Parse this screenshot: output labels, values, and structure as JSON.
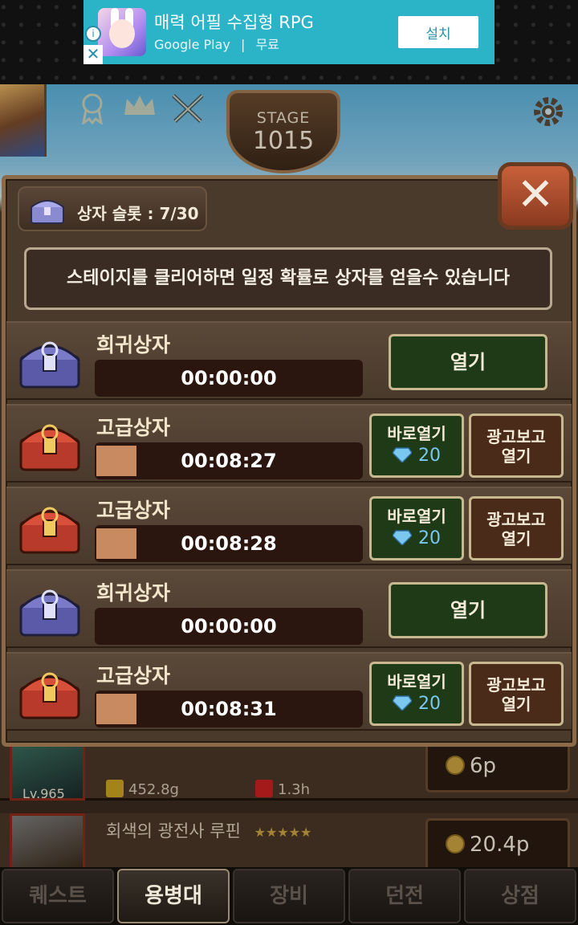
{
  "ad": {
    "title": "매력 어필 수집형 RPG",
    "store": "Google Play",
    "separator": "|",
    "price": "무료",
    "install_label": "설치",
    "info_icon": "i",
    "close_icon": "✕"
  },
  "hud": {
    "stage_label": "STAGE",
    "stage_number": "1015"
  },
  "modal": {
    "slot_label": "상자 슬롯 : 7/30",
    "notice": "스테이지를 클리어하면 일정 확률로 상자를 얻을수 있습니다",
    "close_symbol": "✕",
    "chests": [
      {
        "name": "희귀상자",
        "type": "rare",
        "timer": "00:00:00",
        "progress": 0,
        "open_label": "열기"
      },
      {
        "name": "고급상자",
        "type": "premium",
        "timer": "00:08:27",
        "progress": 0.15,
        "instant_label": "바로열기",
        "gem_cost": "20",
        "ad_label_1": "광고보고",
        "ad_label_2": "열기"
      },
      {
        "name": "고급상자",
        "type": "premium",
        "timer": "00:08:28",
        "progress": 0.15,
        "instant_label": "바로열기",
        "gem_cost": "20",
        "ad_label_1": "광고보고",
        "ad_label_2": "열기"
      },
      {
        "name": "희귀상자",
        "type": "rare",
        "timer": "00:00:00",
        "progress": 0,
        "open_label": "열기"
      },
      {
        "name": "고급상자",
        "type": "premium",
        "timer": "00:08:31",
        "progress": 0.15,
        "instant_label": "바로열기",
        "gem_cost": "20",
        "ad_label_1": "광고보고",
        "ad_label_2": "열기"
      }
    ]
  },
  "background_list": [
    {
      "level": "Lv.965",
      "attack": "452.8g",
      "hp": "1.3h",
      "price": "6p"
    },
    {
      "name": "회색의 광전사 루핀",
      "stars": "★★★★★",
      "price": "20.4p"
    }
  ],
  "tabs": [
    {
      "label": "퀘스트",
      "active": false
    },
    {
      "label": "용병대",
      "active": true
    },
    {
      "label": "장비",
      "active": false
    },
    {
      "label": "던전",
      "active": false
    },
    {
      "label": "상점",
      "active": false
    }
  ],
  "colors": {
    "ad_bg": "#2bb3c8",
    "modal_bg": "#4a3a2c",
    "open_button": "#1e3a16",
    "ad_button": "#4a2a18",
    "timer_fill": "#c88a60",
    "gem": "#7ac8f0"
  }
}
